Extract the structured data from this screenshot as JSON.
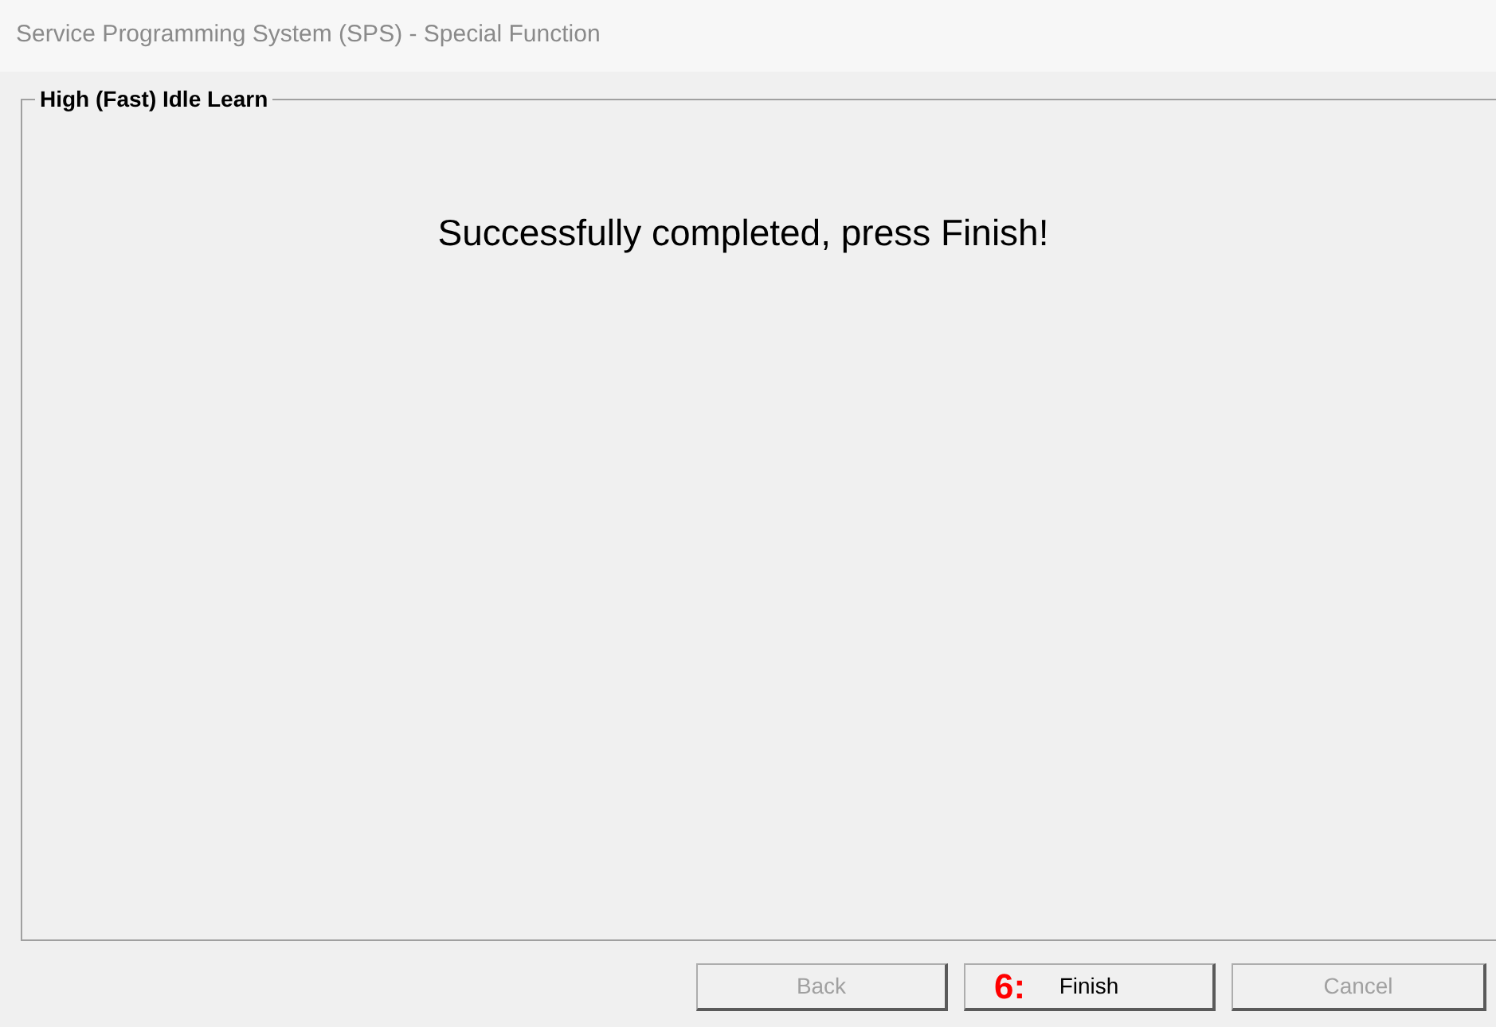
{
  "window": {
    "title": "Service Programming System (SPS) - Special Function"
  },
  "group": {
    "title": "High (Fast) Idle Learn",
    "message": "Successfully completed, press Finish!"
  },
  "buttons": [
    {
      "label": "Back",
      "disabled": true
    },
    {
      "label": "Finish",
      "disabled": false,
      "annotation": "6:"
    },
    {
      "label": "Cancel",
      "disabled": true
    }
  ]
}
